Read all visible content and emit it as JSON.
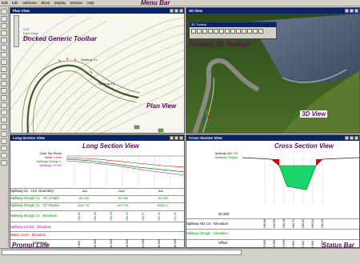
{
  "menu": {
    "items": [
      "Edit",
      "Edit",
      "Attributes",
      "Block",
      "Display",
      "Window",
      "Help"
    ],
    "callout": "Menu Bar"
  },
  "plan": {
    "title": "Plan View",
    "callout_view": "Plan View",
    "callout_toolbar": "Docked Generic Toolbar",
    "road_label_1": "Spillway CL",
    "road_label_2": "Spillway CL",
    "legend": [
      "CLE",
      "Dam Edge",
      "Wire"
    ]
  },
  "view3d": {
    "title": "3D View",
    "toolbar_title": "3D Toolbar",
    "callout_toolbar": "Floating 3D Toolbar",
    "callout_view": "3D View"
  },
  "longsec": {
    "title": "Long Section View",
    "callout": "Long Section View",
    "legend": [
      "Dam Top Plane",
      "Water Level",
      "Spillway Design L",
      "Spillway LS NG"
    ],
    "rows": [
      "Spillway CL - Hor. Geometry",
      "Spillway Design CL - VC Length",
      "Spillway Design CL - VC Radius",
      "Spillway Design CL - Elevation",
      "Spillway LS NG - Elevation",
      "Water Level - Elevation",
      "Chainage"
    ],
    "geom_labels": [
      "Arc",
      "Line",
      "Arc"
    ],
    "vc_length": [
      "80.000",
      "60.000",
      "60.000"
    ],
    "vc_radius": [
      "1647.78",
      "1577.99",
      "1600.11"
    ],
    "chainage": [
      "0.000",
      "16.000",
      "32.000",
      "48.000",
      "64.000",
      "80.000",
      "96.000"
    ],
    "elev": [
      "156.85",
      "156.80",
      "156.66",
      "156.03",
      "155.57",
      "155.02",
      "154.11"
    ],
    "callout_prompt": "Prompt Line"
  },
  "cross": {
    "title": "Cross Section View",
    "callout": "Cross Section View",
    "legend": [
      "Spillway NG CS",
      "Spillway Design"
    ],
    "chainage": "34.000",
    "rows": [
      "Spillway NG CS - Elevation",
      "Spillway Design - Elevation",
      "Offset"
    ],
    "offsets": [
      "-9.000",
      "-6.000",
      "-3.000",
      "0.000",
      "3.000",
      "6.000",
      "9.000"
    ],
    "elevs": [
      "156.96",
      "156.85",
      "156.49",
      "156.72",
      "156.91",
      "156.64",
      "156.20"
    ],
    "callout_status": "Status Bar"
  },
  "status": {
    "prompt": ""
  }
}
